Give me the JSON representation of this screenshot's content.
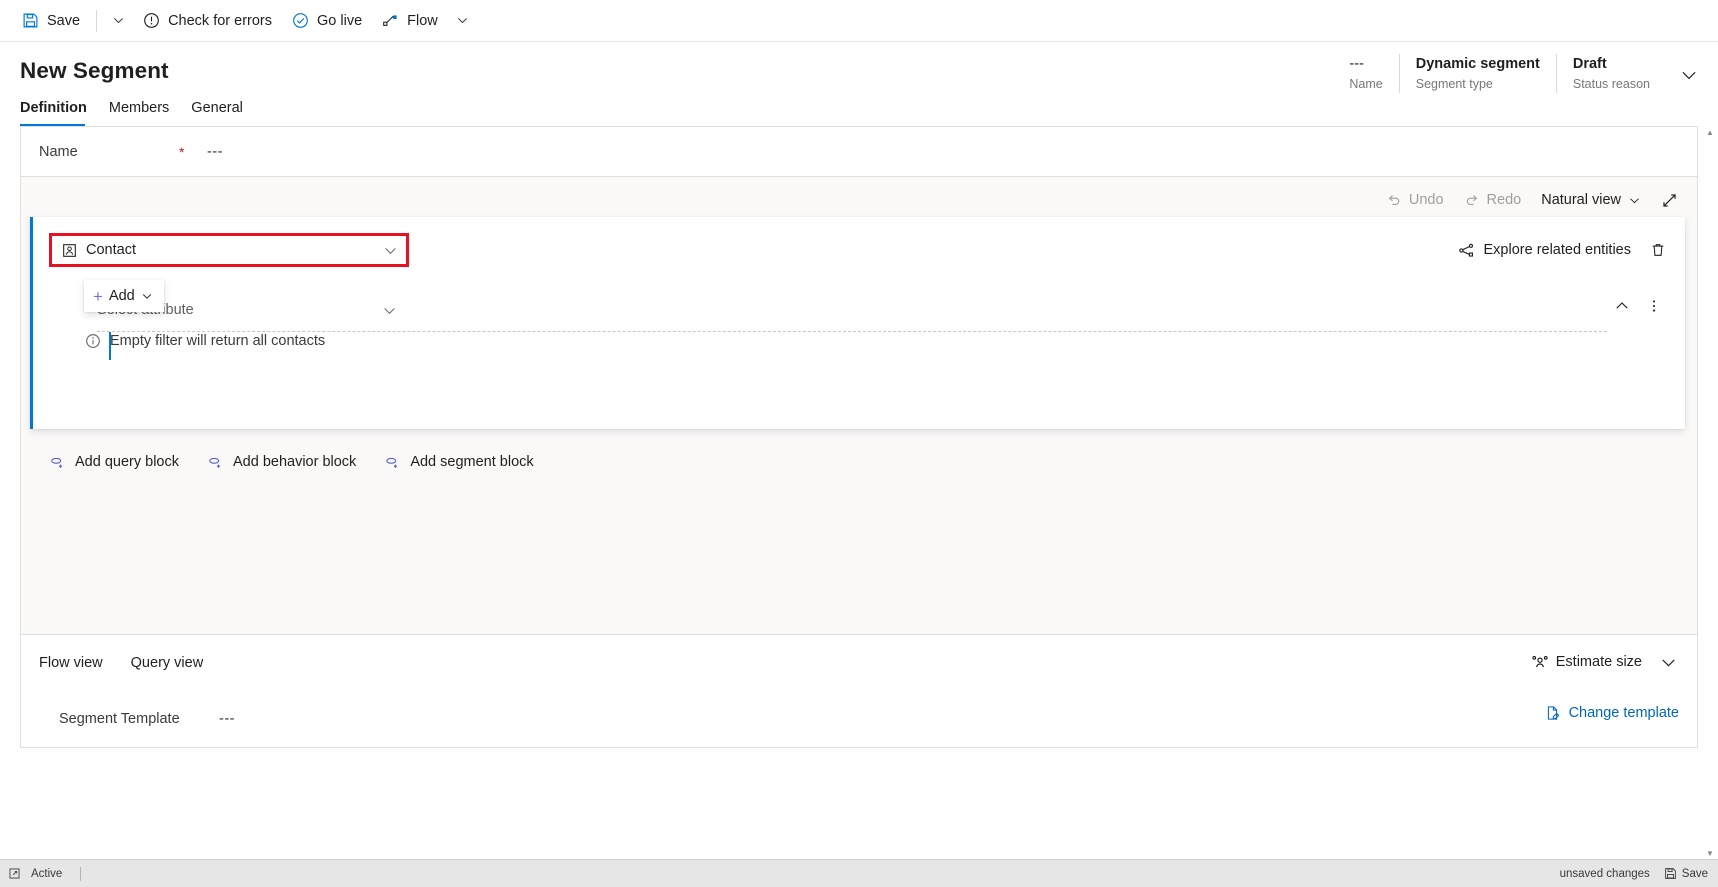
{
  "commandbar": {
    "save_label": "Save",
    "save_icon": "save-disk-icon",
    "save_caret_icon": "chevron-down-icon",
    "check_errors_label": "Check for errors",
    "check_errors_icon": "exclamation-circle-icon",
    "go_live_label": "Go live",
    "go_live_icon": "check-circle-icon",
    "flow_label": "Flow",
    "flow_icon": "flow-icon",
    "flow_caret_icon": "chevron-down-icon"
  },
  "header": {
    "title": "New Segment",
    "fields": [
      {
        "value": "---",
        "label": "Name"
      },
      {
        "value": "Dynamic segment",
        "label": "Segment type"
      },
      {
        "value": "Draft",
        "label": "Status reason"
      }
    ],
    "expand_icon": "chevron-down-icon"
  },
  "tabs": [
    {
      "label": "Definition",
      "active": true
    },
    {
      "label": "Members",
      "active": false
    },
    {
      "label": "General",
      "active": false
    }
  ],
  "name_field": {
    "label": "Name",
    "required_marker": "*",
    "value": "---"
  },
  "canvas_toolbar": {
    "undo_label": "Undo",
    "undo_icon": "undo-arrow-icon",
    "redo_label": "Redo",
    "redo_icon": "redo-arrow-icon",
    "view_mode_label": "Natural view",
    "view_mode_caret_icon": "chevron-down-icon",
    "expand_icon": "expand-diagonal-icon"
  },
  "query_block": {
    "entity": {
      "icon": "contact-entity-icon",
      "value": "Contact",
      "caret_icon": "chevron-down-icon",
      "highlight_color": "#e81123"
    },
    "explore_related_label": "Explore related entities",
    "explore_related_icon": "share-nodes-icon",
    "delete_icon": "trash-icon",
    "attribute": {
      "placeholder": "Select attribute",
      "caret_icon": "chevron-down-icon",
      "collapse_icon": "chevron-up-icon",
      "more_icon": "more-vertical-icon"
    },
    "add_button": {
      "label": "Add",
      "plus_icon": "plus-icon",
      "caret_icon": "chevron-down-icon"
    },
    "info": {
      "icon": "info-circle-icon",
      "text": "Empty filter will return all contacts"
    }
  },
  "block_links": [
    {
      "label": "Add query block",
      "icon": "add-block-icon"
    },
    {
      "label": "Add behavior block",
      "icon": "add-block-icon"
    },
    {
      "label": "Add segment block",
      "icon": "add-block-icon"
    }
  ],
  "footer": {
    "view_tabs": [
      {
        "label": "Flow view",
        "active": true
      },
      {
        "label": "Query view",
        "active": false
      }
    ],
    "estimate_size_label": "Estimate size",
    "estimate_size_icon": "people-icon",
    "estimate_caret_icon": "chevron-down-icon",
    "template_label": "Segment Template",
    "template_value": "---",
    "change_template_label": "Change template",
    "change_template_icon": "edit-page-icon"
  },
  "statusbar": {
    "expand_icon": "popout-icon",
    "state_label": "Active",
    "unsaved_label": "unsaved changes",
    "save_label": "Save",
    "save_icon": "save-disk-icon"
  },
  "colors": {
    "accent": "#0078d4",
    "link": "#0067b8",
    "highlight": "#e81123",
    "canvas_bg": "#faf9f8"
  }
}
